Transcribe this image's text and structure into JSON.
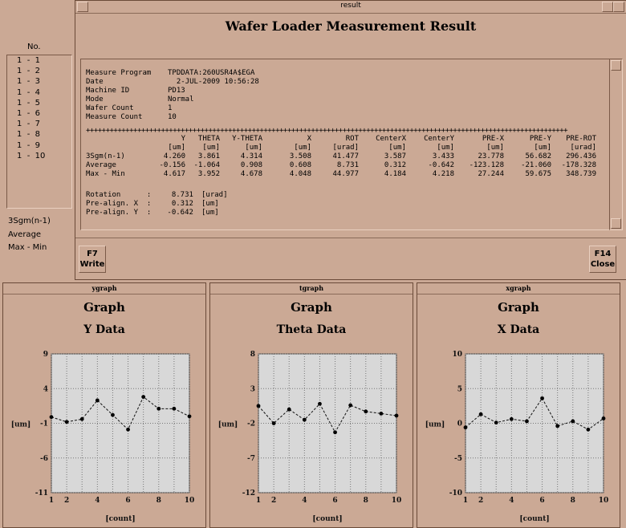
{
  "left_panel": {
    "header": "No.",
    "items": [
      "1  -  1",
      "1  -  2",
      "1  -  3",
      "1  -  4",
      "1  -  5",
      "1  -  6",
      "1  -  7",
      "1  -  8",
      "1  -  9",
      "1  -  10"
    ],
    "stats": [
      "3Sgm(n-1)",
      "Average",
      "Max - Min"
    ]
  },
  "result_window": {
    "window_title": "result",
    "heading": "Wafer Loader Measurement Result",
    "info": [
      {
        "label": "Measure Program",
        "value": "TPDDATA:260USR4A$EGA"
      },
      {
        "label": "Date",
        "value": "  2-JUL-2009 10:56:28"
      },
      {
        "label": "Machine ID",
        "value": "PD13"
      },
      {
        "label": "Mode",
        "value": "Normal"
      },
      {
        "label": "Wafer Count",
        "value": "1"
      },
      {
        "label": "Measure Count",
        "value": "10"
      }
    ],
    "separator": "++++++++++++++++++++++++++++++++++++++++++++++++++++++++++++++++++++++++++++++++++++++++++++++++++++++++++++++++++++++++++",
    "columns": [
      "Y",
      "THETA",
      "Y-THETA",
      "X",
      "ROT",
      "CenterX",
      "CenterY",
      "PRE-X",
      "PRE-Y",
      "PRE-ROT"
    ],
    "units": [
      "[um]",
      "[um]",
      "[um]",
      "[um]",
      "[urad]",
      "[um]",
      "[um]",
      "[um]",
      "[um]",
      "[urad]"
    ],
    "rows": [
      {
        "label": "3Sgm(n-1)",
        "values": [
          "4.260",
          "3.861",
          "4.314",
          "3.508",
          "41.477",
          "3.587",
          "3.433",
          "23.778",
          "56.682",
          "296.436"
        ]
      },
      {
        "label": "Average",
        "values": [
          "-0.156",
          "-1.064",
          "0.908",
          "0.608",
          "8.731",
          "0.312",
          "-0.642",
          "-123.128",
          "-21.060",
          "-178.328"
        ]
      },
      {
        "label": "Max - Min",
        "values": [
          "4.617",
          "3.952",
          "4.678",
          "4.048",
          "44.977",
          "4.184",
          "4.218",
          "27.244",
          "59.675",
          "348.739"
        ]
      }
    ],
    "summary": [
      {
        "label": "Rotation      :",
        "value": "  8.731",
        "unit": "[urad]"
      },
      {
        "label": "Pre-align. X  :",
        "value": "  0.312",
        "unit": "[um]"
      },
      {
        "label": "Pre-align. Y  :",
        "value": " -0.642",
        "unit": "[um]"
      }
    ],
    "buttons": {
      "write_key": "F7",
      "write_label": "Write",
      "close_key": "F14",
      "close_label": "Close"
    }
  },
  "chart_data": [
    {
      "type": "line",
      "window_title": "ygraph",
      "title": "Graph",
      "subtitle": "Y Data",
      "xlabel": "[count]",
      "ylabel": "[um]",
      "x": [
        1,
        2,
        3,
        4,
        5,
        6,
        7,
        8,
        9,
        10
      ],
      "values": [
        -0.1,
        -0.8,
        -0.4,
        2.3,
        0.2,
        -1.9,
        2.8,
        1.1,
        1.1,
        0.0
      ],
      "xlim": [
        1,
        10
      ],
      "ylim": [
        -11,
        9
      ],
      "yticks": [
        9,
        4,
        -1,
        -6,
        -11
      ],
      "xticks": [
        1,
        2,
        4,
        6,
        8,
        10
      ],
      "grid": true
    },
    {
      "type": "line",
      "window_title": "tgraph",
      "title": "Graph",
      "subtitle": "Theta Data",
      "xlabel": "[count]",
      "ylabel": "[um]",
      "x": [
        1,
        2,
        3,
        4,
        5,
        6,
        7,
        8,
        9,
        10
      ],
      "values": [
        0.5,
        -2.0,
        0.0,
        -1.5,
        0.8,
        -3.3,
        0.6,
        -0.3,
        -0.6,
        -0.9
      ],
      "xlim": [
        1,
        10
      ],
      "ylim": [
        -12,
        8
      ],
      "yticks": [
        8,
        3,
        -2,
        -7,
        -12
      ],
      "xticks": [
        1,
        2,
        4,
        6,
        8,
        10
      ],
      "grid": true
    },
    {
      "type": "line",
      "window_title": "xgraph",
      "title": "Graph",
      "subtitle": "X Data",
      "xlabel": "[count]",
      "ylabel": "[um]",
      "x": [
        1,
        2,
        3,
        4,
        5,
        6,
        7,
        8,
        9,
        10
      ],
      "values": [
        -0.6,
        1.3,
        0.1,
        0.6,
        0.3,
        3.6,
        -0.4,
        0.3,
        -0.9,
        0.7
      ],
      "xlim": [
        1,
        10
      ],
      "ylim": [
        -10,
        10
      ],
      "yticks": [
        10,
        5,
        0,
        -5,
        -10
      ],
      "xticks": [
        1,
        2,
        4,
        6,
        8,
        10
      ],
      "grid": true
    }
  ]
}
